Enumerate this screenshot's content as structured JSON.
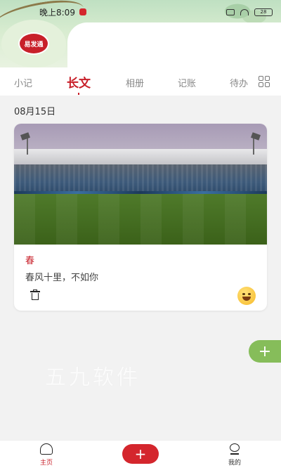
{
  "status_bar": {
    "time": "晚上8:09",
    "battery": "28"
  },
  "header": {
    "logo_text": "易发通"
  },
  "tabs": [
    {
      "label": "小记",
      "active": false
    },
    {
      "label": "长文",
      "active": true
    },
    {
      "label": "相册",
      "active": false
    },
    {
      "label": "记账",
      "active": false
    },
    {
      "label": "待办",
      "active": false
    }
  ],
  "date_label": "08月15日",
  "entry": {
    "title": "春",
    "text": "春风十里，不如你"
  },
  "watermark": "五九软件",
  "bottom_nav": {
    "home_label": "主页",
    "add_label": "+",
    "mine_label": "我的"
  },
  "fab_label": "+",
  "colors": {
    "accent": "#c8202a",
    "fab": "#86bd5a",
    "background": "#f2f2f2"
  }
}
